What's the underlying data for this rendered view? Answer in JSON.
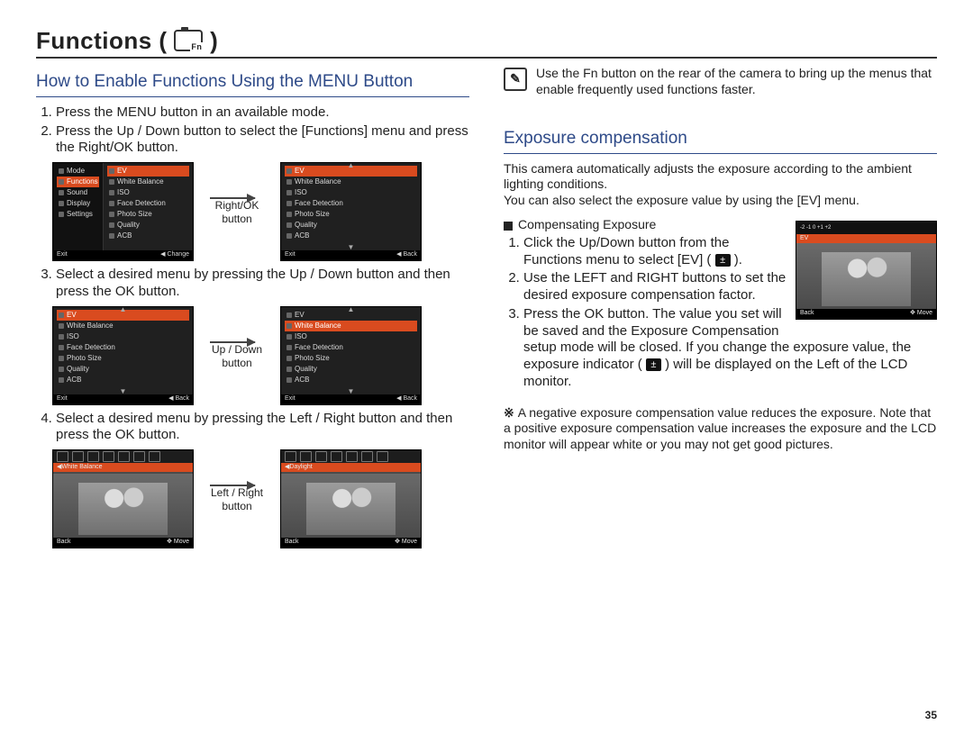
{
  "page_number": "35",
  "title": "Functions (",
  "title_icon": "camera-fn-icon",
  "title_close": " )",
  "left": {
    "heading": "How to Enable Functions Using the MENU Button",
    "step1": "Press the MENU button in an available mode.",
    "step2": "Press the Up / Down button to select the [Functions] menu and press the Right/OK button.",
    "cap1": "Right/OK button",
    "step3": "Select a desired menu by pressing the Up / Down button and then press the OK button.",
    "cap2": "Up / Down button",
    "step4": "Select a desired menu by pressing the Left / Right button and then press the OK button.",
    "cap3": "Left / Right button"
  },
  "menu_left_panel": [
    "Mode",
    "Functions",
    "Sound",
    "Display",
    "Settings"
  ],
  "menu_left_selected": "Functions",
  "menu_right_items": [
    "EV",
    "White Balance",
    "ISO",
    "Face Detection",
    "Photo Size",
    "Quality",
    "ACB"
  ],
  "menu_bar": {
    "left": "Exit",
    "mid": "Change",
    "back": "Back"
  },
  "wb_selected": "White Balance",
  "wb_value": "Daylight",
  "photo_bar": {
    "left": "Back",
    "right": "Move"
  },
  "right": {
    "note": "Use the Fn button on the rear of the camera to bring up the menus that enable frequently used functions faster.",
    "heading": "Exposure compensation",
    "intro1": "This camera automatically adjusts the exposure according to the ambient lighting conditions.",
    "intro2": "You can also select the exposure value by using the [EV] menu.",
    "list_title": "Compensating Exposure",
    "s1a": "Click the Up/Down button from the Functions menu to select [EV] (",
    "s1b": " ).",
    "s2": "Use the LEFT and RIGHT buttons to set the desired exposure compensation factor.",
    "s3a": "Press the OK button. The value you set will be saved and the Exposure Compensation setup mode will be closed. If you change the exposure value, the exposure indicator (",
    "s3b": " ) will be displayed on the Left of the LCD monitor.",
    "foot": "A negative exposure compensation value reduces the exposure. Note that a positive exposure compensation value increases the exposure and the LCD monitor will appear white or you may not get good pictures.",
    "ev_strip": "EV",
    "ev_ticks": "-2  -1  0  +1  +2"
  }
}
